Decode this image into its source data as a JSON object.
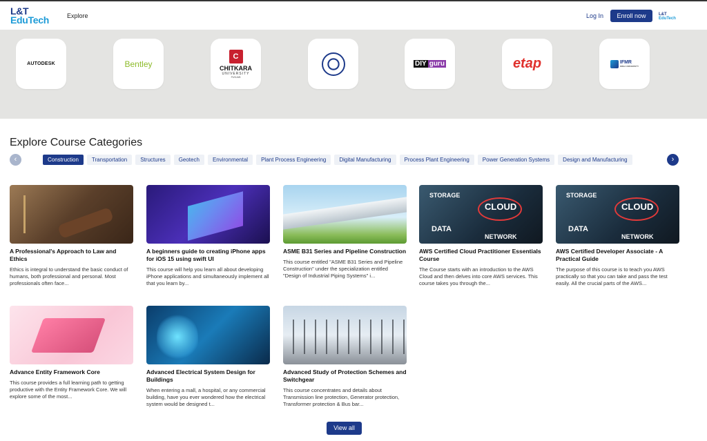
{
  "header": {
    "logo_line1": "L&T",
    "logo_line2": "EduTech",
    "nav_explore": "Explore",
    "login": "Log In",
    "enroll": "Enroll now",
    "mini_logo_line1": "L&T",
    "mini_logo_line2": "EduTech"
  },
  "partners": {
    "autodesk": "AUTODESK",
    "bentley": "Bentley",
    "chitkara_mark": "C",
    "chitkara_name": "CHITKARA",
    "chitkara_sub": "UNIVERSITY",
    "chitkara_place": "PUNJAB",
    "diy_part1": "DIY",
    "diy_part2": "guru",
    "etap": "etap",
    "ifmr": "IFMR",
    "ifmr_sub": "KREA UNIVERSITY"
  },
  "categories": {
    "title": "Explore Course Categories",
    "items": [
      "Construction",
      "Transportation",
      "Structures",
      "Geotech",
      "Environmental",
      "Plant Process Engineering",
      "Digital Manufacturing",
      "Process Plant Engineering",
      "Power Generation Systems",
      "Design and Manufacturing"
    ],
    "active_index": 0
  },
  "courses": [
    {
      "title": "A Professional's Approach to Law and Ethics",
      "desc": "Ethics is integral to understand the basic conduct of humans, both professional and personal. Most professionals often face..."
    },
    {
      "title": "A beginners guide to creating iPhone apps for iOS 15 using swift UI",
      "desc": "This course will help you learn all about developing iPhone applications and simultaneously implement all that you learn by..."
    },
    {
      "title": "ASME B31 Series and Pipeline Construction",
      "desc": "This course entitled \"ASME B31 Series and Pipeline Construction\" under the specialization entitled \"Design of Industrial Piping Systems\" i..."
    },
    {
      "title": "AWS Certified Cloud Practitioner Essentials Course",
      "desc": "The Course starts with an introduction to the AWS Cloud and then delves into core AWS services. This course takes you through the...",
      "thumb_labels": [
        "STORAGE",
        "CLOUD",
        "DATA",
        "NETWORK"
      ]
    },
    {
      "title": "AWS Certified Developer Associate - A Practical Guide",
      "desc": "The purpose of this course is to teach you AWS practically so that you can take and pass the test easily. All the crucial parts of the AWS...",
      "thumb_labels": [
        "STORAGE",
        "CLOUD",
        "DATA",
        "NETWORK"
      ]
    },
    {
      "title": "Advance Entity Framework Core",
      "desc": "This course provides a full learning path to getting productive with the Entity Framework Core. We will explore some of the most..."
    },
    {
      "title": "Advanced Electrical System Design for Buildings",
      "desc": "When entering a mall, a hospital, or any commercial building, have you ever wondered how the electrical system would be designed t..."
    },
    {
      "title": "Advanced Study of Protection Schemes and Switchgear",
      "desc": "This course concentrates and details about Transmission line protection, Generator protection, Transformer protection & Bus bar..."
    }
  ],
  "view_all": "View all",
  "icons": {
    "prev": "chevron-left-icon",
    "next": "chevron-right-icon"
  },
  "colors": {
    "brand": "#1d3a8a",
    "accent": "#1d9bd7"
  }
}
